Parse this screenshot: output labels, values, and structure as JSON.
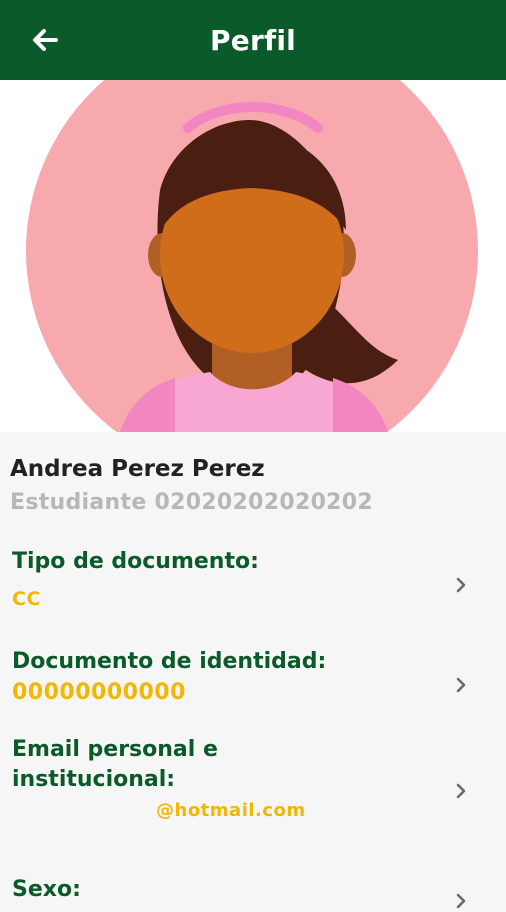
{
  "header": {
    "title": "Perfil",
    "back_icon": "arrow-left-icon",
    "background": "#0b5b2a"
  },
  "profile": {
    "name": "Andrea Perez Perez",
    "role_and_id": "Estudiante 02020202020202",
    "avatar_icon": "female-avatar-icon"
  },
  "fields": [
    {
      "label": "Tipo de documento:",
      "value": "CC"
    },
    {
      "label": "Documento de identidad:",
      "value": "00000000000"
    },
    {
      "label_line1": "Email personal e",
      "label_line2": "institucional:",
      "value": "@hotmail.com"
    },
    {
      "label": "Sexo:"
    }
  ],
  "colors": {
    "primary": "#0b5b2a",
    "accent": "#f2b705",
    "muted": "#b7b7b7"
  }
}
